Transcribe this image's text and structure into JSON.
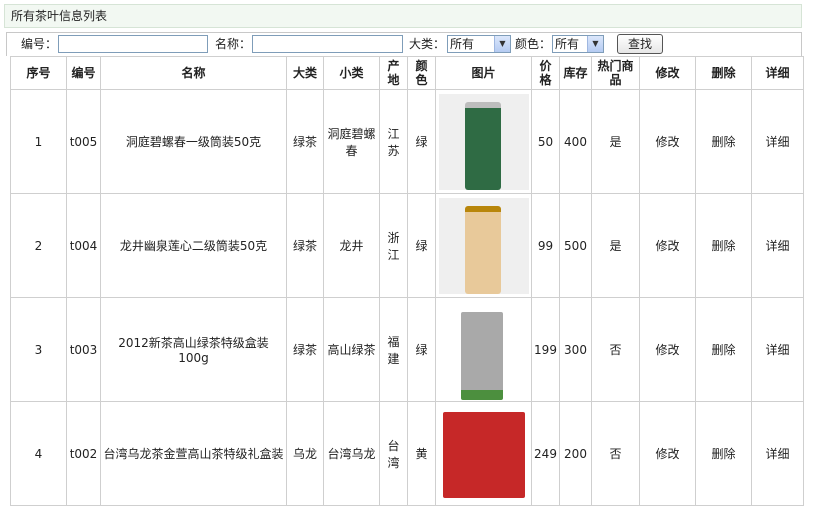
{
  "header": {
    "title": "所有茶叶信息列表"
  },
  "search": {
    "code_label": "编号：",
    "name_label": "名称：",
    "category_label": "大类：",
    "category_value": "所有",
    "color_label": "颜色：",
    "color_value": "所有",
    "submit_label": "查找"
  },
  "columns": [
    "序号",
    "编号",
    "名称",
    "大类",
    "小类",
    "产地",
    "颜色",
    "图片",
    "价格",
    "库存",
    "热门商品",
    "修改",
    "删除",
    "详细"
  ],
  "rows": [
    {
      "index": "1",
      "code": "t005",
      "name": "洞庭碧螺春一级筒装50克",
      "category": "绿茶",
      "subcategory": "洞庭碧螺春",
      "origin": "江苏",
      "color": "绿",
      "price": "50",
      "stock": "400",
      "hot": "是",
      "edit": "修改",
      "delete": "删除",
      "detail": "详细"
    },
    {
      "index": "2",
      "code": "t004",
      "name": "龙井幽泉莲心二级筒装50克",
      "category": "绿茶",
      "subcategory": "龙井",
      "origin": "浙江",
      "color": "绿",
      "price": "99",
      "stock": "500",
      "hot": "是",
      "edit": "修改",
      "delete": "删除",
      "detail": "详细"
    },
    {
      "index": "3",
      "code": "t003",
      "name": "2012新茶高山绿茶特级盒装100g",
      "category": "绿茶",
      "subcategory": "高山绿茶",
      "origin": "福建",
      "color": "绿",
      "price": "199",
      "stock": "300",
      "hot": "否",
      "edit": "修改",
      "delete": "删除",
      "detail": "详细"
    },
    {
      "index": "4",
      "code": "t002",
      "name": "台湾乌龙茶金萱高山茶特级礼盒装",
      "category": "乌龙",
      "subcategory": "台湾乌龙",
      "origin": "台湾",
      "color": "黄",
      "price": "249",
      "stock": "200",
      "hot": "否",
      "edit": "修改",
      "delete": "删除",
      "detail": "详细"
    }
  ],
  "images": {
    "can_colors": [
      "#2f6b44",
      "#e8c99a",
      "#a9a9a9",
      "#c62828"
    ],
    "image_icons": [
      "tea-can-green-icon",
      "tea-can-beige-icon",
      "tea-box-silver-icon",
      "tea-box-red-icon"
    ]
  }
}
